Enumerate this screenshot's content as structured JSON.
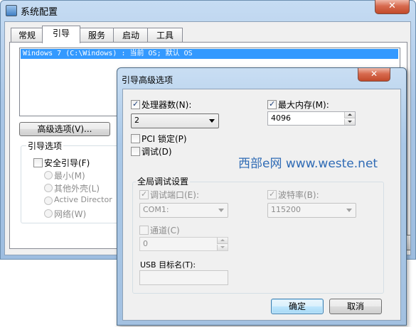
{
  "main_window": {
    "title": "系统配置",
    "close_glyph": "✕",
    "tabs": [
      "常规",
      "引导",
      "服务",
      "启动",
      "工具"
    ],
    "active_tab": "引导",
    "boot_entries": [
      "Windows 7 (C:\\Windows) : 当前 OS; 默认 OS"
    ],
    "advanced_button": "高级选项(V)...",
    "boot_options": {
      "title": "引导选项",
      "safe_boot": "安全引导(F)",
      "minimal": "最小(M)",
      "other_shell": "其他外壳(L)",
      "active_directory": "Active Director",
      "network": "网络(W)"
    }
  },
  "dialog": {
    "title": "引导高级选项",
    "close_glyph": "✕",
    "num_processors": {
      "label": "处理器数(N):",
      "checked": true,
      "value": "2"
    },
    "max_memory": {
      "label": "最大内存(M):",
      "checked": true,
      "value": "4096"
    },
    "pci_lock": {
      "label": "PCI 锁定(P)",
      "checked": false
    },
    "debug": {
      "label": "调试(D)",
      "checked": false
    },
    "global_debug": {
      "title": "全局调试设置",
      "debug_port": {
        "label": "调试端口(E):",
        "checked": true,
        "value": "COM1:"
      },
      "baud_rate": {
        "label": "波特率(B):",
        "checked": true,
        "value": "115200"
      },
      "channel": {
        "label": "通道(C)",
        "checked": false,
        "value": "0"
      },
      "usb_target": {
        "label": "USB 目标名(T):",
        "value": ""
      }
    },
    "ok_button": "确定",
    "cancel_button": "取消"
  },
  "watermark": "西部e网 www.weste.net"
}
